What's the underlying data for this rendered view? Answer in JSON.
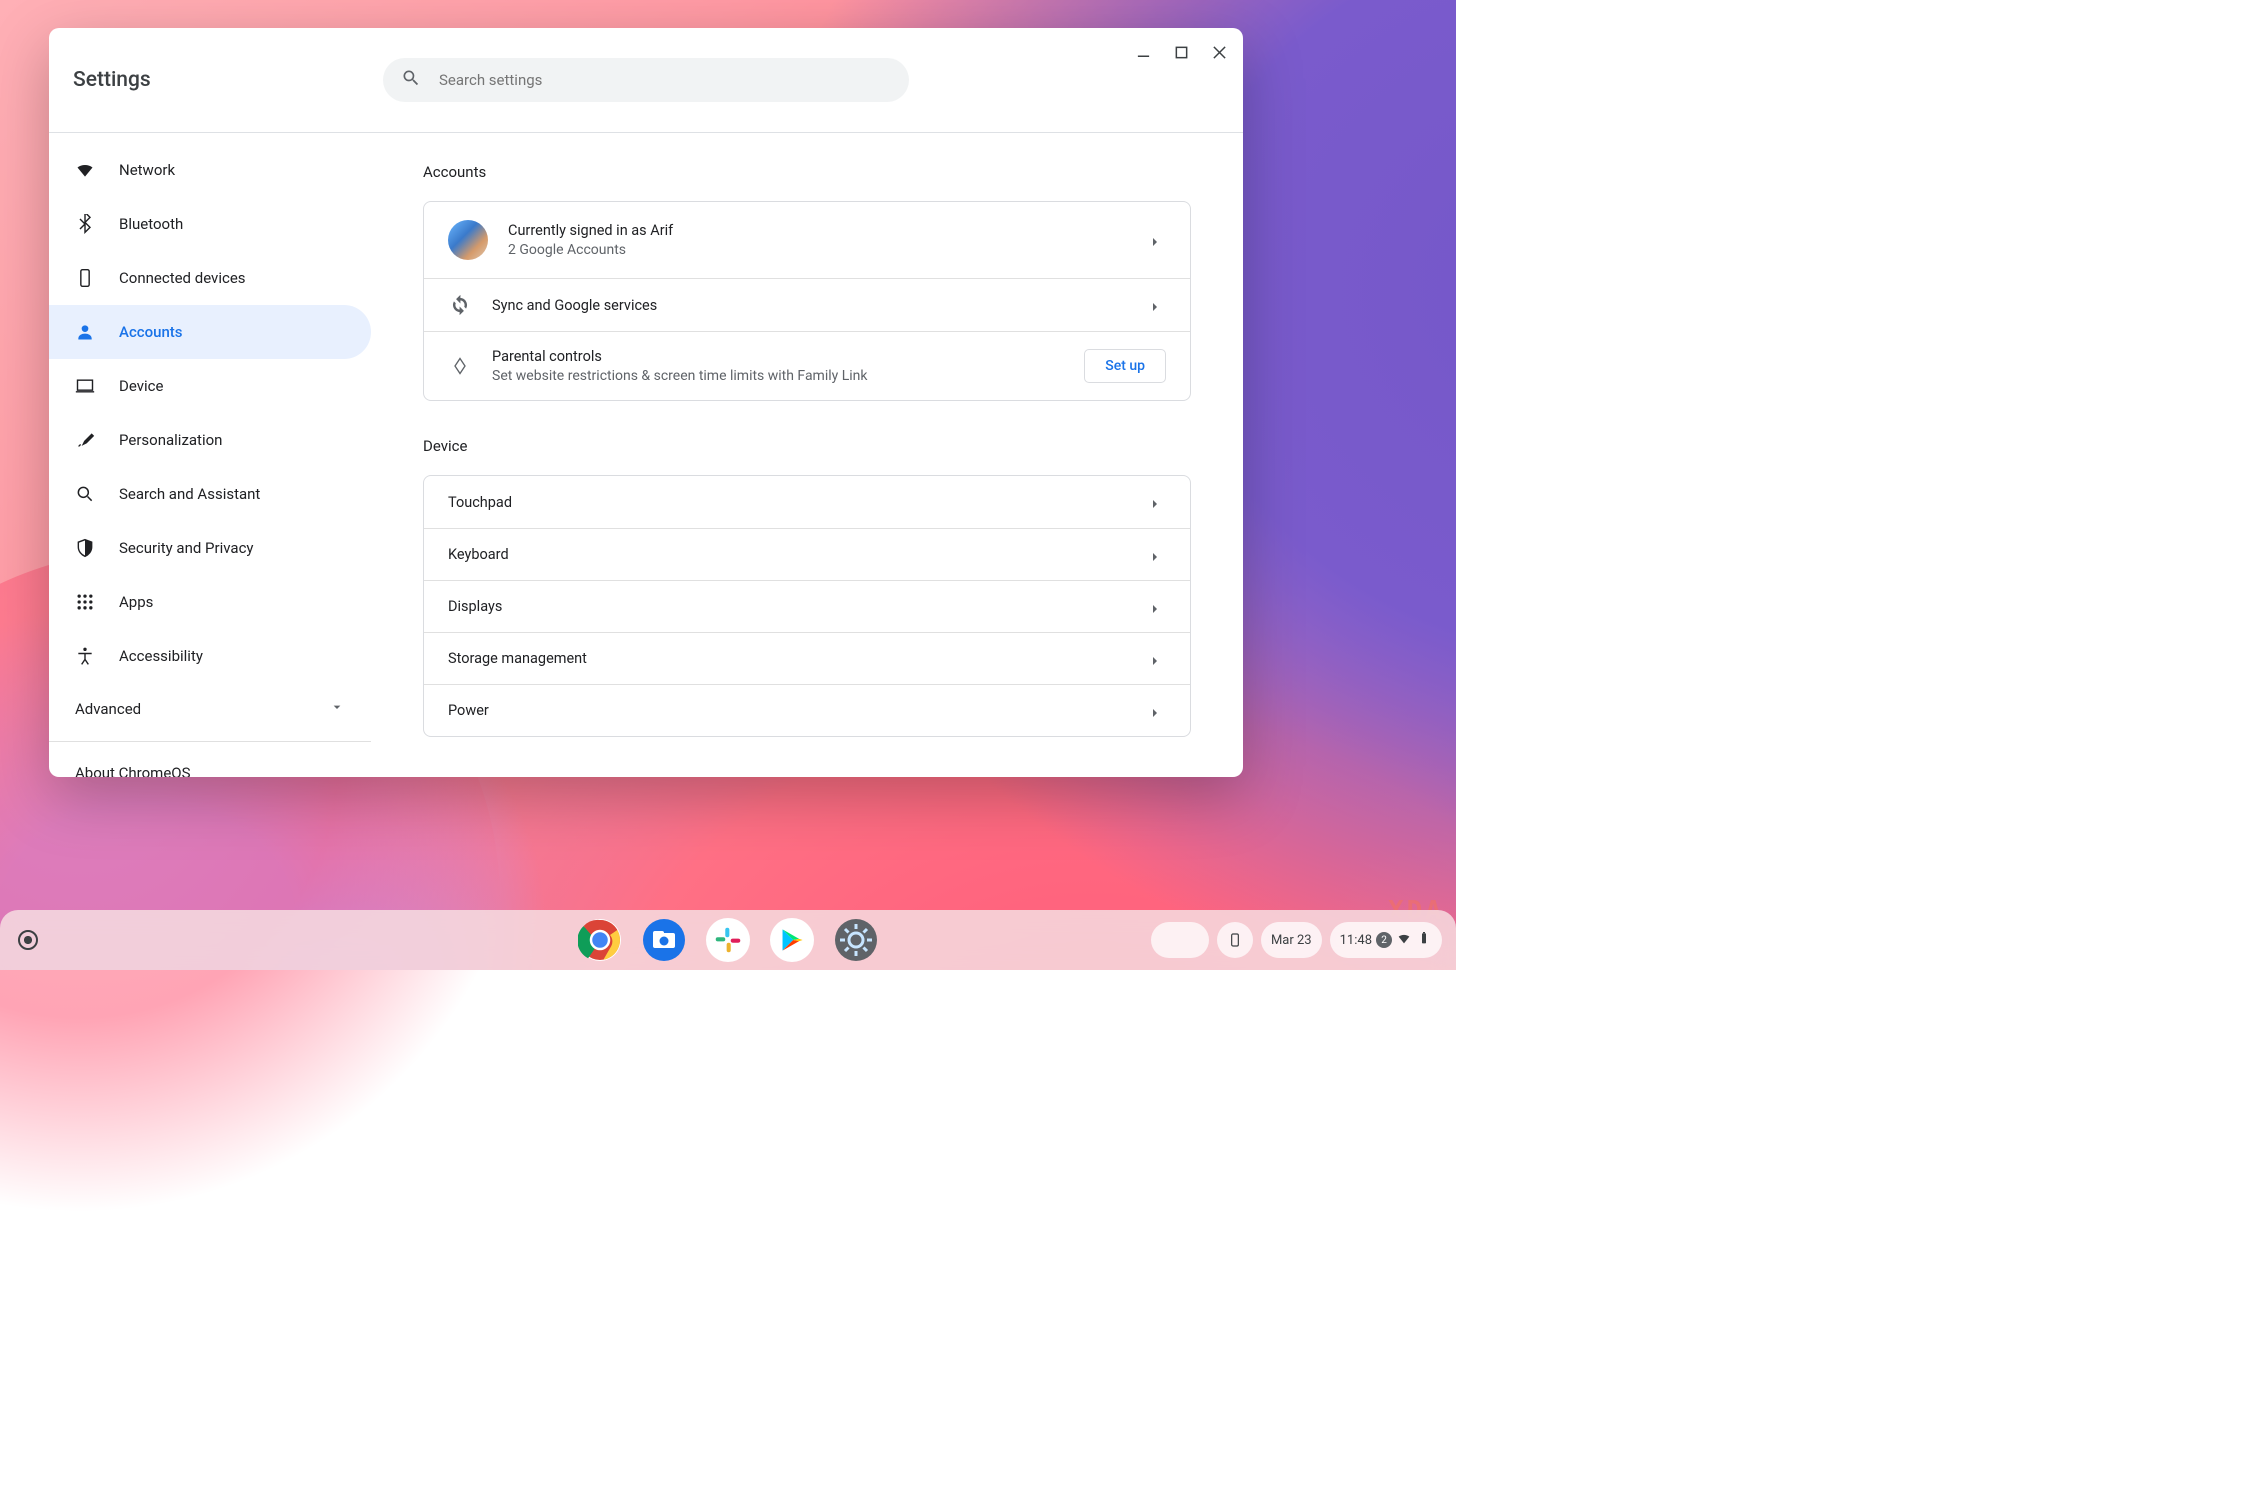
{
  "window": {
    "app_title": "Settings",
    "search_placeholder": "Search settings"
  },
  "sidebar": {
    "items": [
      {
        "id": "network",
        "label": "Network"
      },
      {
        "id": "bluetooth",
        "label": "Bluetooth"
      },
      {
        "id": "connected",
        "label": "Connected devices"
      },
      {
        "id": "accounts",
        "label": "Accounts"
      },
      {
        "id": "device",
        "label": "Device"
      },
      {
        "id": "personalization",
        "label": "Personalization"
      },
      {
        "id": "search",
        "label": "Search and Assistant"
      },
      {
        "id": "security",
        "label": "Security and Privacy"
      },
      {
        "id": "apps",
        "label": "Apps"
      },
      {
        "id": "accessibility",
        "label": "Accessibility"
      }
    ],
    "advanced": "Advanced",
    "about": "About ChromeOS"
  },
  "accounts": {
    "title": "Accounts",
    "signed_in": {
      "primary": "Currently signed in as Arif",
      "secondary": "2 Google Accounts"
    },
    "sync": {
      "primary": "Sync and Google services"
    },
    "parental": {
      "primary": "Parental controls",
      "secondary": "Set website restrictions & screen time limits with Family Link",
      "button": "Set up"
    }
  },
  "device": {
    "title": "Device",
    "rows": [
      {
        "label": "Touchpad"
      },
      {
        "label": "Keyboard"
      },
      {
        "label": "Displays"
      },
      {
        "label": "Storage management"
      },
      {
        "label": "Power"
      }
    ]
  },
  "shelf": {
    "date": "Mar 23",
    "time": "11:48",
    "notification_count": "2"
  },
  "watermark": "XDA"
}
